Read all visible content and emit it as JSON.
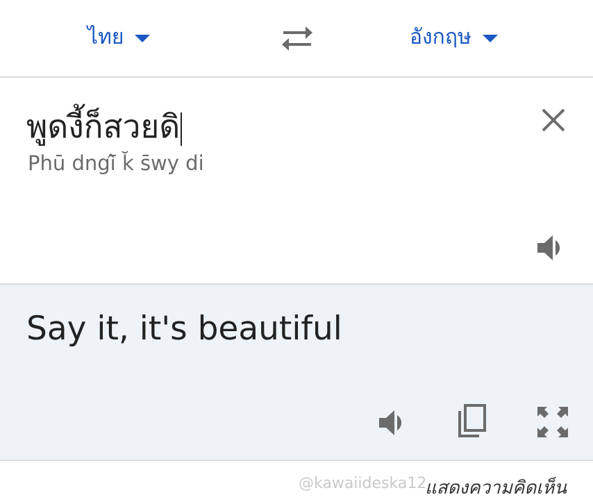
{
  "languages": {
    "source_label": "ไทย",
    "target_label": "อังกฤษ"
  },
  "source": {
    "text": "พูดงี้ก็สวยดิ",
    "transliteration": "Phū dngī̂ k̆ s̄wy di"
  },
  "result": {
    "text": "Say it, it's beautiful"
  },
  "footer": {
    "watermark": "@kawaiideska12",
    "comment_link": "แสดงความคิดเห็น"
  },
  "colors": {
    "accent": "#1a57c2",
    "icon_gray": "#6b6b6b",
    "result_background": "#eef3f7",
    "divider": "#dcdcdc"
  },
  "icons": {
    "language_caret": "caret-down-icon",
    "swap": "swap-languages-icon",
    "clear": "close-icon",
    "speak": "speaker-icon",
    "copy": "copy-icon",
    "fullscreen": "fullscreen-icon"
  }
}
